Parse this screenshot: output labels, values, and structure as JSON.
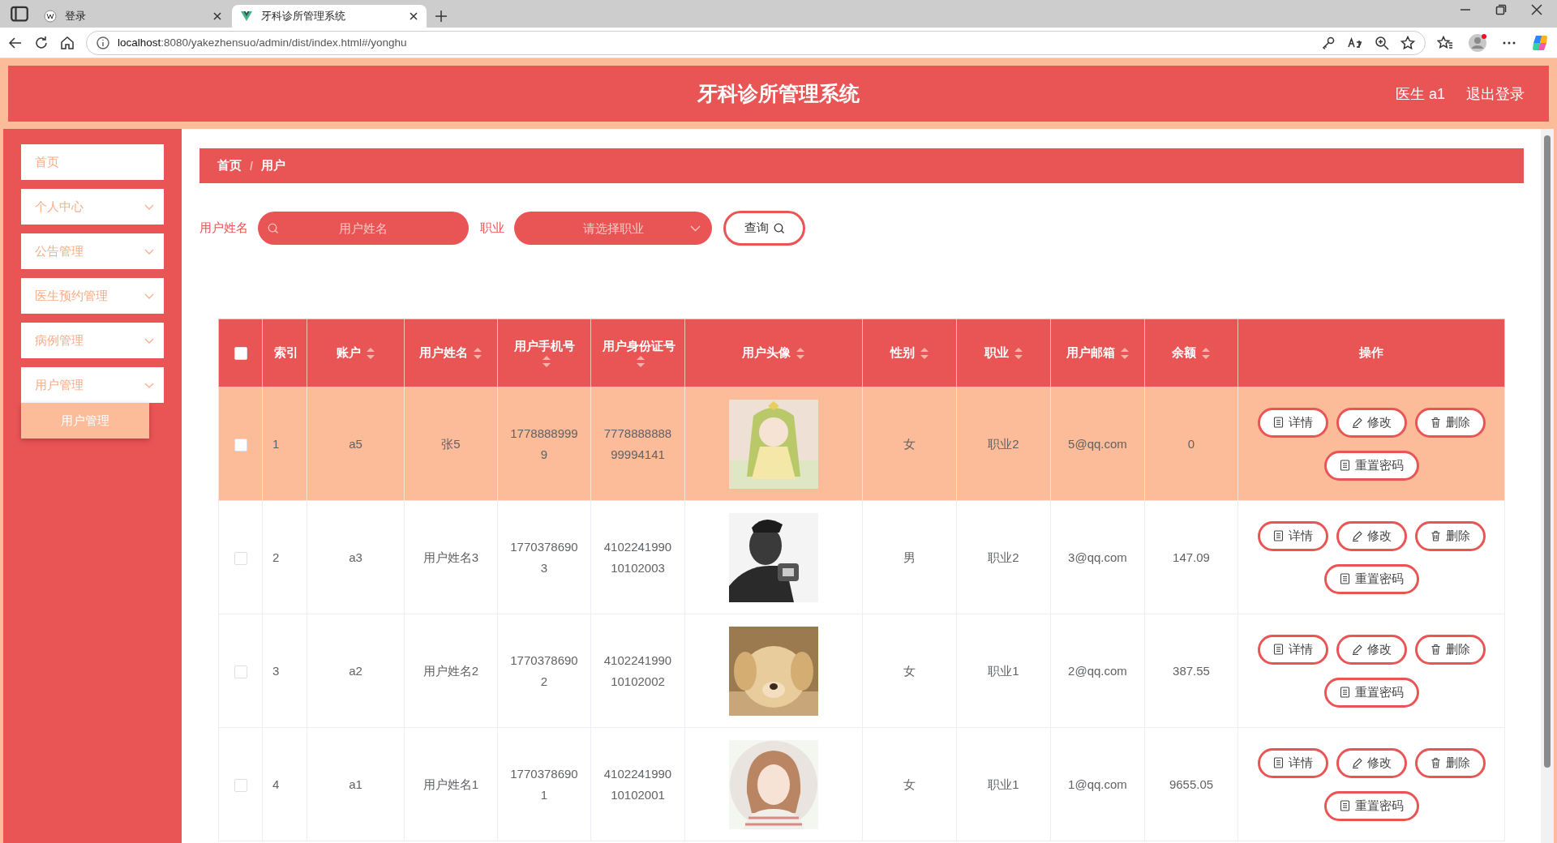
{
  "browser": {
    "tabs": [
      {
        "title": "登录",
        "selected": false
      },
      {
        "title": "牙科诊所管理系统",
        "selected": true
      }
    ],
    "address": {
      "host": "localhost",
      "path": ":8080/yakezhensuo/admin/dist/index.html#/yonghu"
    }
  },
  "header": {
    "title": "牙科诊所管理系统",
    "user": "医生 a1",
    "logout": "退出登录"
  },
  "sidebar": {
    "items": [
      {
        "kind": "link",
        "label": "首页"
      },
      {
        "kind": "submenu",
        "label": "个人中心"
      },
      {
        "kind": "submenu",
        "label": "公告管理"
      },
      {
        "kind": "submenu",
        "label": "医生预约管理"
      },
      {
        "kind": "submenu",
        "label": "病例管理"
      },
      {
        "kind": "submenu",
        "label": "用户管理",
        "children": [
          {
            "label": "用户管理",
            "selected": true
          }
        ]
      }
    ]
  },
  "breadcrumb": {
    "items": [
      "首页",
      "用户"
    ],
    "separator": "/"
  },
  "search": {
    "fields": [
      {
        "kind": "input",
        "label": "用户姓名",
        "placeholder": "用户姓名"
      },
      {
        "kind": "select",
        "label": "职业",
        "placeholder": "请选择职业"
      }
    ],
    "button": "查询"
  },
  "table": {
    "columns": [
      {
        "kind": "checkbox",
        "checked": false
      },
      {
        "kind": "text",
        "label": "索引",
        "sortable": false
      },
      {
        "kind": "text",
        "label": "账户",
        "sortable": true
      },
      {
        "kind": "text",
        "label": "用户姓名",
        "sortable": true
      },
      {
        "kind": "text",
        "label": "用户手机号",
        "sortable": true
      },
      {
        "kind": "text",
        "label": "用户身份证号",
        "sortable": true
      },
      {
        "label": "用户头像",
        "sortable": true
      },
      {
        "kind": "text",
        "label": "性别",
        "sortable": true
      },
      {
        "kind": "text",
        "label": "职业",
        "sortable": true
      },
      {
        "kind": "text",
        "label": "用户邮箱",
        "sortable": true
      },
      {
        "kind": "text",
        "label": "余额",
        "sortable": true
      },
      {
        "kind": "actions",
        "label": "操作",
        "sortable": false
      }
    ],
    "rows": [
      {
        "selected": true,
        "checked": false,
        "cells": [
          "",
          "1",
          "a5",
          "张5",
          "17788889999",
          "777888888899994141",
          "",
          "女",
          "职业2",
          "5@qq.com",
          "0",
          ""
        ],
        "actions": [
          {
            "kind": "detail",
            "label": "详情"
          },
          {
            "kind": "edit",
            "label": "修改"
          },
          {
            "kind": "delete",
            "label": "删除"
          },
          {
            "kind": "reset",
            "label": "重置密码"
          }
        ]
      },
      {
        "selected": false,
        "checked": false,
        "cells": [
          "",
          "2",
          "a3",
          "用户姓名3",
          "17703786903",
          "410224199010102003",
          "",
          "男",
          "职业2",
          "3@qq.com",
          "147.09",
          ""
        ],
        "actions": [
          {
            "kind": "detail",
            "label": "详情"
          },
          {
            "kind": "edit",
            "label": "修改"
          },
          {
            "kind": "delete",
            "label": "删除"
          },
          {
            "kind": "reset",
            "label": "重置密码"
          }
        ]
      },
      {
        "selected": false,
        "checked": false,
        "cells": [
          "",
          "3",
          "a2",
          "用户姓名2",
          "17703786902",
          "410224199010102002",
          "",
          "女",
          "职业1",
          "2@qq.com",
          "387.55",
          ""
        ],
        "actions": [
          {
            "kind": "detail",
            "label": "详情"
          },
          {
            "kind": "edit",
            "label": "修改"
          },
          {
            "kind": "delete",
            "label": "删除"
          },
          {
            "kind": "reset",
            "label": "重置密码"
          }
        ]
      },
      {
        "selected": false,
        "checked": false,
        "cells": [
          "",
          "4",
          "a1",
          "用户姓名1",
          "17703786901",
          "410224199010102001",
          "",
          "女",
          "职业1",
          "1@qq.com",
          "9655.05",
          ""
        ],
        "actions": [
          {
            "kind": "detail",
            "label": "详情"
          },
          {
            "kind": "edit",
            "label": "修改"
          },
          {
            "kind": "delete",
            "label": "删除"
          },
          {
            "kind": "reset",
            "label": "重置密码"
          }
        ]
      }
    ]
  }
}
